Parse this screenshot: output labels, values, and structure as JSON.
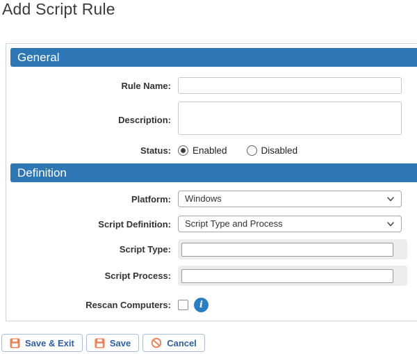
{
  "page": {
    "title": "Add Script Rule"
  },
  "sections": {
    "general": {
      "header": "General",
      "fields": {
        "rule_name": {
          "label": "Rule Name:",
          "value": ""
        },
        "description": {
          "label": "Description:",
          "value": ""
        },
        "status": {
          "label": "Status:",
          "options": [
            {
              "label": "Enabled",
              "selected": true
            },
            {
              "label": "Disabled",
              "selected": false
            }
          ]
        }
      }
    },
    "definition": {
      "header": "Definition",
      "fields": {
        "platform": {
          "label": "Platform:",
          "value": "Windows"
        },
        "script_definition": {
          "label": "Script Definition:",
          "value": "Script Type and Process"
        },
        "script_type": {
          "label": "Script Type:",
          "value": ""
        },
        "script_process": {
          "label": "Script Process:",
          "value": ""
        },
        "rescan_computers": {
          "label": "Rescan Computers:",
          "checked": false,
          "info_icon": "info-icon"
        }
      }
    }
  },
  "footer": {
    "save_exit_label": "Save & Exit",
    "save_label": "Save",
    "cancel_label": "Cancel"
  },
  "colors": {
    "section_header_bg": "#2e76b4",
    "button_text": "#2f5f9e",
    "button_border": "#a5bfdd",
    "icon_orange": "#e8845d",
    "info_badge_bg": "#2a7ec2",
    "disabled_strip_bg": "#ececec"
  }
}
